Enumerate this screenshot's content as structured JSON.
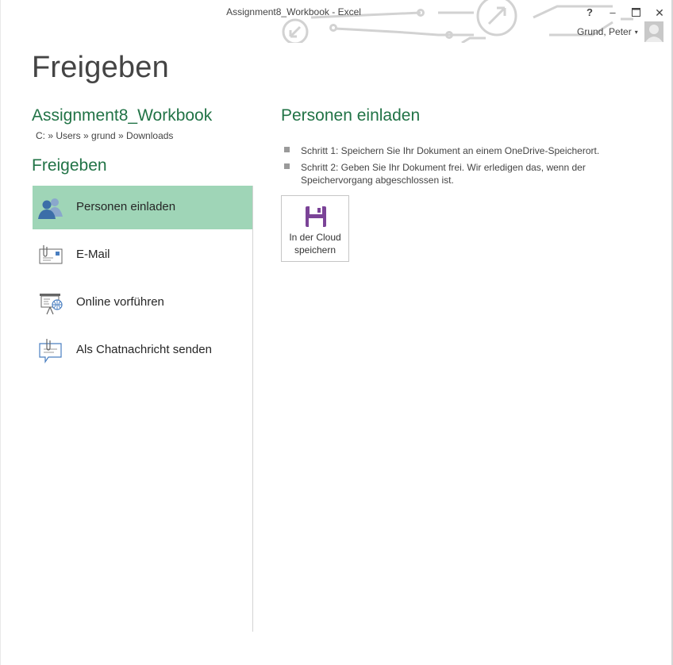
{
  "window": {
    "title": "Assignment8_Workbook - Excel",
    "help_label": "?",
    "minimize_label": "–",
    "close_label": "✕",
    "user_name": "Grund, Peter"
  },
  "page": {
    "title": "Freigeben"
  },
  "document": {
    "name": "Assignment8_Workbook",
    "path": "C: » Users » grund » Downloads"
  },
  "share": {
    "section_title": "Freigeben",
    "items": [
      {
        "label": "Personen einladen",
        "icon": "invite-people-icon",
        "active": true
      },
      {
        "label": "E-Mail",
        "icon": "email-attachment-icon",
        "active": false
      },
      {
        "label": "Online vorführen",
        "icon": "present-online-icon",
        "active": false
      },
      {
        "label": "Als Chatnachricht senden",
        "icon": "chat-message-icon",
        "active": false
      }
    ]
  },
  "detail": {
    "title": "Personen einladen",
    "steps": [
      "Schritt 1: Speichern Sie Ihr Dokument an einem OneDrive-Speicherort.",
      "Schritt 2: Geben Sie Ihr Dokument frei. Wir erledigen das, wenn der Speichervorgang abgeschlossen ist."
    ],
    "save_button": {
      "line1": "In der Cloud",
      "line2": "speichern",
      "icon": "floppy-disk-icon"
    }
  },
  "colors": {
    "accent": "#217346",
    "active_item": "#9fd5b7",
    "save_icon": "#7b4397",
    "people_icon_blue": "#3c6ea8"
  }
}
